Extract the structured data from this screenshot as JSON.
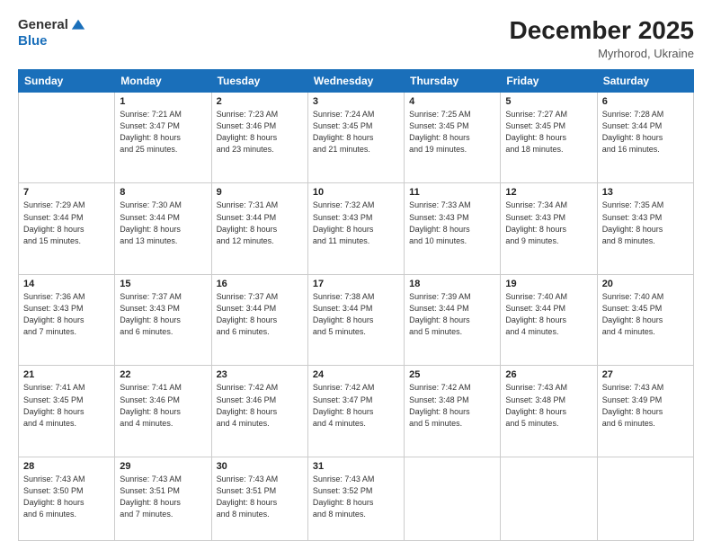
{
  "header": {
    "logo_general": "General",
    "logo_blue": "Blue",
    "title": "December 2025",
    "location": "Myrhorod, Ukraine"
  },
  "days_of_week": [
    "Sunday",
    "Monday",
    "Tuesday",
    "Wednesday",
    "Thursday",
    "Friday",
    "Saturday"
  ],
  "weeks": [
    [
      {
        "date": "",
        "info": ""
      },
      {
        "date": "1",
        "info": "Sunrise: 7:21 AM\nSunset: 3:47 PM\nDaylight: 8 hours\nand 25 minutes."
      },
      {
        "date": "2",
        "info": "Sunrise: 7:23 AM\nSunset: 3:46 PM\nDaylight: 8 hours\nand 23 minutes."
      },
      {
        "date": "3",
        "info": "Sunrise: 7:24 AM\nSunset: 3:45 PM\nDaylight: 8 hours\nand 21 minutes."
      },
      {
        "date": "4",
        "info": "Sunrise: 7:25 AM\nSunset: 3:45 PM\nDaylight: 8 hours\nand 19 minutes."
      },
      {
        "date": "5",
        "info": "Sunrise: 7:27 AM\nSunset: 3:45 PM\nDaylight: 8 hours\nand 18 minutes."
      },
      {
        "date": "6",
        "info": "Sunrise: 7:28 AM\nSunset: 3:44 PM\nDaylight: 8 hours\nand 16 minutes."
      }
    ],
    [
      {
        "date": "7",
        "info": "Sunrise: 7:29 AM\nSunset: 3:44 PM\nDaylight: 8 hours\nand 15 minutes."
      },
      {
        "date": "8",
        "info": "Sunrise: 7:30 AM\nSunset: 3:44 PM\nDaylight: 8 hours\nand 13 minutes."
      },
      {
        "date": "9",
        "info": "Sunrise: 7:31 AM\nSunset: 3:44 PM\nDaylight: 8 hours\nand 12 minutes."
      },
      {
        "date": "10",
        "info": "Sunrise: 7:32 AM\nSunset: 3:43 PM\nDaylight: 8 hours\nand 11 minutes."
      },
      {
        "date": "11",
        "info": "Sunrise: 7:33 AM\nSunset: 3:43 PM\nDaylight: 8 hours\nand 10 minutes."
      },
      {
        "date": "12",
        "info": "Sunrise: 7:34 AM\nSunset: 3:43 PM\nDaylight: 8 hours\nand 9 minutes."
      },
      {
        "date": "13",
        "info": "Sunrise: 7:35 AM\nSunset: 3:43 PM\nDaylight: 8 hours\nand 8 minutes."
      }
    ],
    [
      {
        "date": "14",
        "info": "Sunrise: 7:36 AM\nSunset: 3:43 PM\nDaylight: 8 hours\nand 7 minutes."
      },
      {
        "date": "15",
        "info": "Sunrise: 7:37 AM\nSunset: 3:43 PM\nDaylight: 8 hours\nand 6 minutes."
      },
      {
        "date": "16",
        "info": "Sunrise: 7:37 AM\nSunset: 3:44 PM\nDaylight: 8 hours\nand 6 minutes."
      },
      {
        "date": "17",
        "info": "Sunrise: 7:38 AM\nSunset: 3:44 PM\nDaylight: 8 hours\nand 5 minutes."
      },
      {
        "date": "18",
        "info": "Sunrise: 7:39 AM\nSunset: 3:44 PM\nDaylight: 8 hours\nand 5 minutes."
      },
      {
        "date": "19",
        "info": "Sunrise: 7:40 AM\nSunset: 3:44 PM\nDaylight: 8 hours\nand 4 minutes."
      },
      {
        "date": "20",
        "info": "Sunrise: 7:40 AM\nSunset: 3:45 PM\nDaylight: 8 hours\nand 4 minutes."
      }
    ],
    [
      {
        "date": "21",
        "info": "Sunrise: 7:41 AM\nSunset: 3:45 PM\nDaylight: 8 hours\nand 4 minutes."
      },
      {
        "date": "22",
        "info": "Sunrise: 7:41 AM\nSunset: 3:46 PM\nDaylight: 8 hours\nand 4 minutes."
      },
      {
        "date": "23",
        "info": "Sunrise: 7:42 AM\nSunset: 3:46 PM\nDaylight: 8 hours\nand 4 minutes."
      },
      {
        "date": "24",
        "info": "Sunrise: 7:42 AM\nSunset: 3:47 PM\nDaylight: 8 hours\nand 4 minutes."
      },
      {
        "date": "25",
        "info": "Sunrise: 7:42 AM\nSunset: 3:48 PM\nDaylight: 8 hours\nand 5 minutes."
      },
      {
        "date": "26",
        "info": "Sunrise: 7:43 AM\nSunset: 3:48 PM\nDaylight: 8 hours\nand 5 minutes."
      },
      {
        "date": "27",
        "info": "Sunrise: 7:43 AM\nSunset: 3:49 PM\nDaylight: 8 hours\nand 6 minutes."
      }
    ],
    [
      {
        "date": "28",
        "info": "Sunrise: 7:43 AM\nSunset: 3:50 PM\nDaylight: 8 hours\nand 6 minutes."
      },
      {
        "date": "29",
        "info": "Sunrise: 7:43 AM\nSunset: 3:51 PM\nDaylight: 8 hours\nand 7 minutes."
      },
      {
        "date": "30",
        "info": "Sunrise: 7:43 AM\nSunset: 3:51 PM\nDaylight: 8 hours\nand 8 minutes."
      },
      {
        "date": "31",
        "info": "Sunrise: 7:43 AM\nSunset: 3:52 PM\nDaylight: 8 hours\nand 8 minutes."
      },
      {
        "date": "",
        "info": ""
      },
      {
        "date": "",
        "info": ""
      },
      {
        "date": "",
        "info": ""
      }
    ]
  ]
}
